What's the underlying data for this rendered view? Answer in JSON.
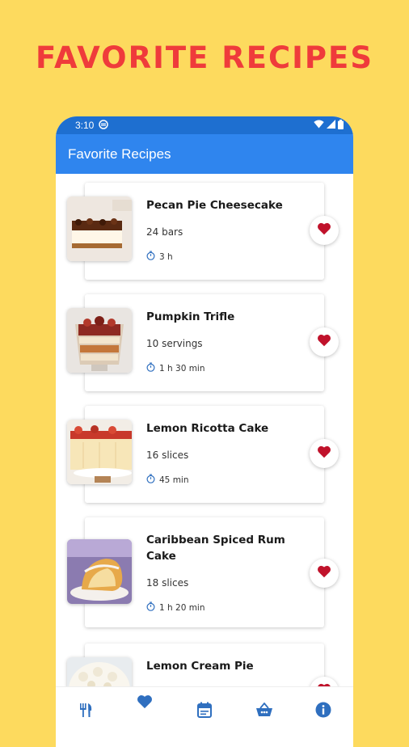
{
  "promo": {
    "title": "FAVORITE RECIPES"
  },
  "status_bar": {
    "time": "3:10"
  },
  "app_bar": {
    "title": "Favorite Recipes"
  },
  "recipes": [
    {
      "title": "Pecan Pie Cheesecake",
      "yield": "24 bars",
      "time": "3 h",
      "favorite": true
    },
    {
      "title": "Pumpkin Trifle",
      "yield": "10 servings",
      "time": "1 h 30 min",
      "favorite": true
    },
    {
      "title": "Lemon Ricotta Cake",
      "yield": "16 slices",
      "time": "45 min",
      "favorite": true
    },
    {
      "title": "Caribbean Spiced Rum Cake",
      "yield": "18 slices",
      "time": "1 h 20 min",
      "favorite": true
    },
    {
      "title": "Lemon Cream Pie",
      "yield": "",
      "time": "",
      "favorite": true
    }
  ],
  "bottom_nav": [
    {
      "icon": "utensils-icon",
      "active": false
    },
    {
      "icon": "heart-icon",
      "active": true
    },
    {
      "icon": "calendar-icon",
      "active": false
    },
    {
      "icon": "basket-icon",
      "active": false
    },
    {
      "icon": "info-icon",
      "active": false
    }
  ],
  "colors": {
    "background": "#FDDA5E",
    "promo_title": "#EF3B3B",
    "app_bar": "#2F85EE",
    "status_bar": "#1E6FD0",
    "heart": "#C0122B",
    "nav_icon": "#2F6FBF"
  }
}
